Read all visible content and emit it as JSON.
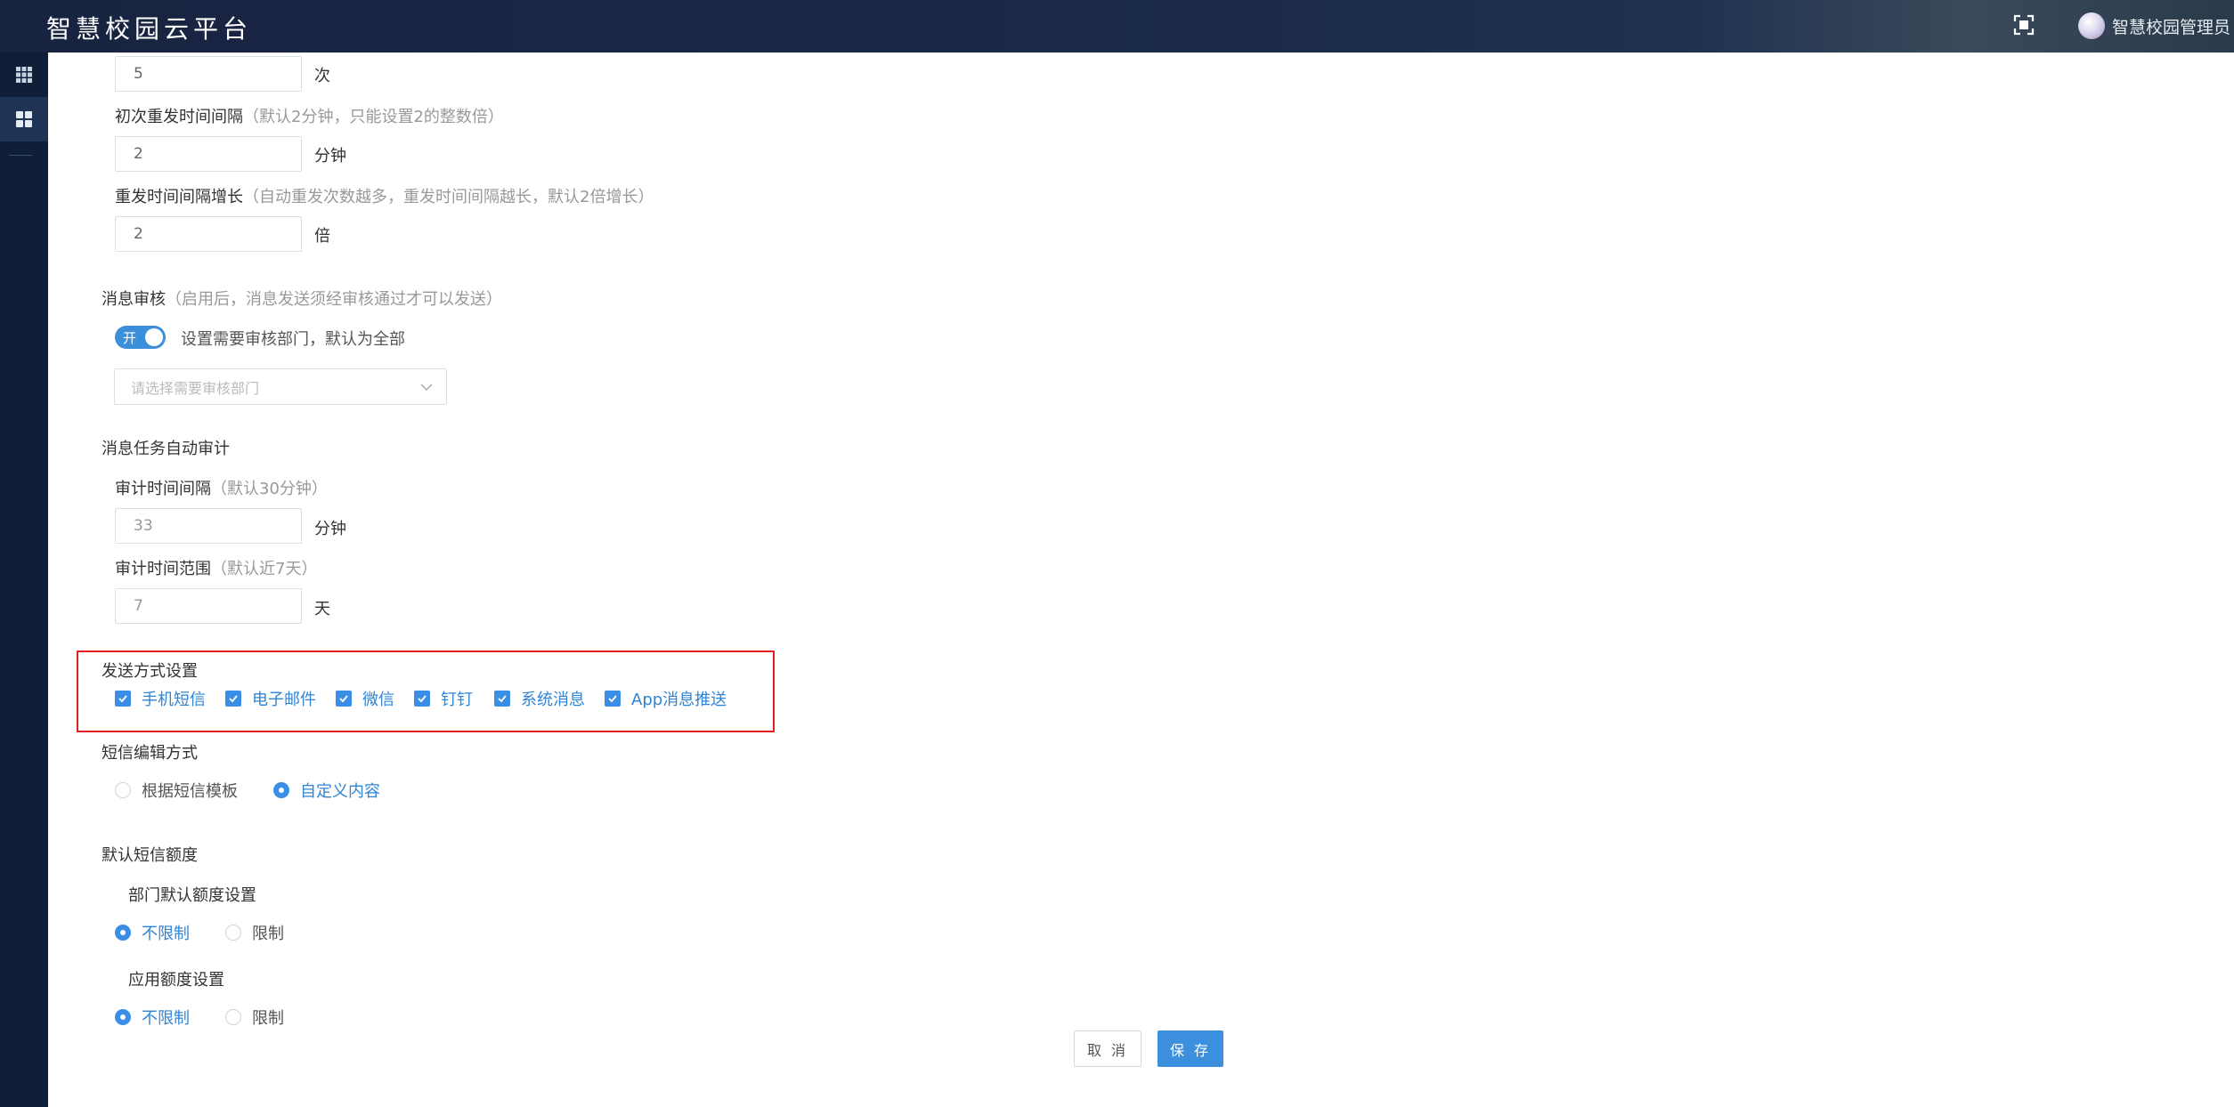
{
  "header": {
    "app_title": "智慧校园云平台",
    "user_name": "智慧校园管理员",
    "fullscreen_icon": "fullscreen-icon"
  },
  "sidebar": {
    "items": [
      {
        "icon": "grid-apps-icon",
        "active": false
      },
      {
        "icon": "dashboard-icon",
        "active": true
      }
    ]
  },
  "retry": {
    "count_value": "5",
    "count_unit": "次",
    "first_interval_label": "初次重发时间间隔",
    "first_interval_hint": "（默认2分钟，只能设置2的整数倍）",
    "first_interval_value": "2",
    "first_interval_unit": "分钟",
    "growth_label": "重发时间间隔增长",
    "growth_hint": "（自动重发次数越多，重发时间间隔越长，默认2倍增长）",
    "growth_value": "2",
    "growth_unit": "倍"
  },
  "review": {
    "title": "消息审核",
    "hint": "（启用后，消息发送须经审核通过才可以发送）",
    "toggle_label": "开",
    "toggle_on": true,
    "dept_hint": "设置需要审核部门，默认为全部",
    "dept_placeholder": "请选择需要审核部门"
  },
  "audit": {
    "title": "消息任务自动审计",
    "interval_label": "审计时间间隔",
    "interval_hint": "（默认30分钟）",
    "interval_value": "33",
    "interval_unit": "分钟",
    "range_label": "审计时间范围",
    "range_hint": "（默认近7天）",
    "range_value": "7",
    "range_unit": "天"
  },
  "send_methods": {
    "title": "发送方式设置",
    "options": [
      {
        "label": "手机短信",
        "checked": true
      },
      {
        "label": "电子邮件",
        "checked": true
      },
      {
        "label": "微信",
        "checked": true
      },
      {
        "label": "钉钉",
        "checked": true
      },
      {
        "label": "系统消息",
        "checked": true
      },
      {
        "label": "App消息推送",
        "checked": true
      }
    ],
    "highlight_color": "#e0201f"
  },
  "sms_edit": {
    "title": "短信编辑方式",
    "options": [
      {
        "label": "根据短信模板",
        "selected": false
      },
      {
        "label": "自定义内容",
        "selected": true
      }
    ]
  },
  "sms_quota": {
    "title": "默认短信额度",
    "dept_label": "部门默认额度设置",
    "dept_options": [
      {
        "label": "不限制",
        "selected": true
      },
      {
        "label": "限制",
        "selected": false
      }
    ],
    "app_label": "应用额度设置",
    "app_options": [
      {
        "label": "不限制",
        "selected": true
      },
      {
        "label": "限制",
        "selected": false
      }
    ]
  },
  "actions": {
    "cancel_label": "取 消",
    "save_label": "保 存"
  },
  "colors": {
    "accent": "#3a8ee6",
    "header_bg": "#17233f",
    "sidebar_bg": "#0f1f38"
  }
}
